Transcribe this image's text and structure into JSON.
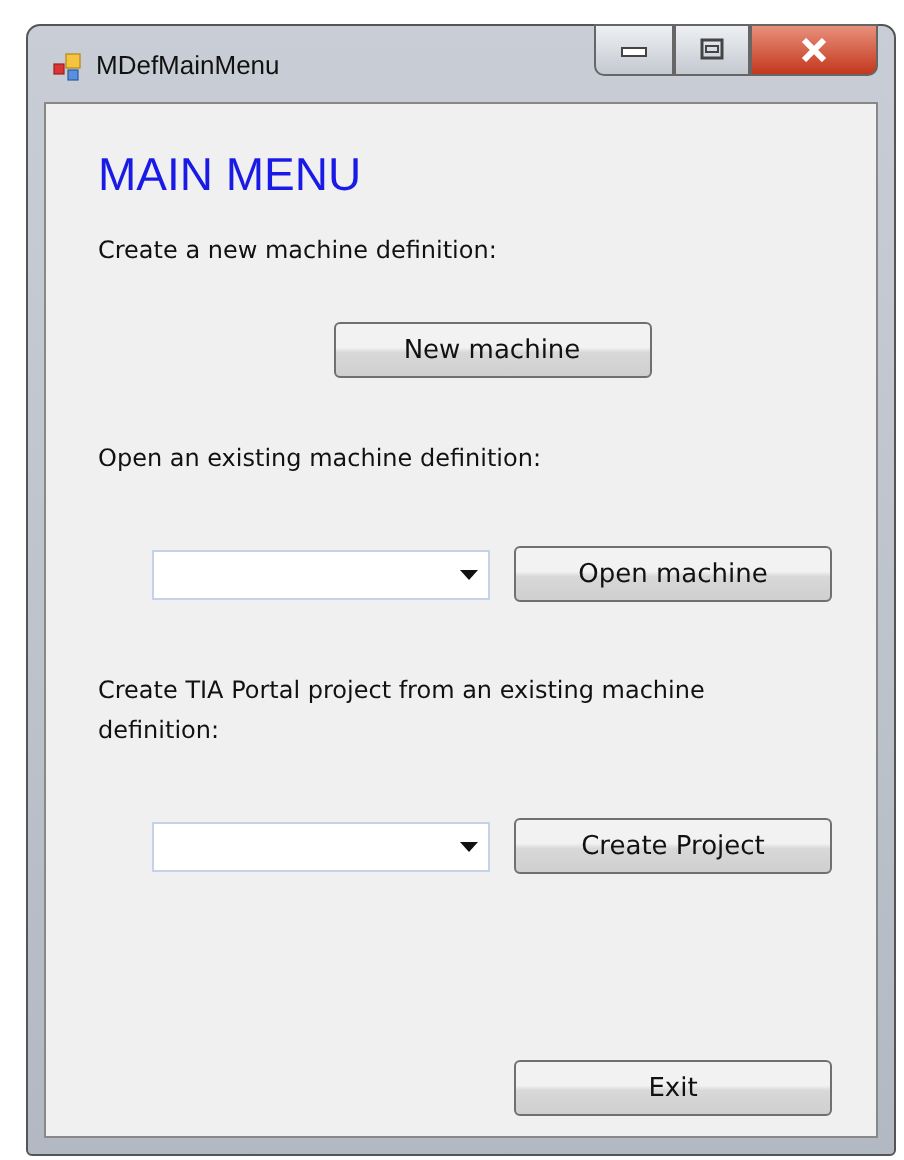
{
  "window": {
    "title": "MDefMainMenu"
  },
  "heading": "MAIN MENU",
  "sections": [
    {
      "label": "Create a new machine definition:",
      "button": "New machine",
      "kind": "button"
    },
    {
      "label": "Open an existing machine definition:",
      "button": "Open machine",
      "kind": "combo"
    },
    {
      "label": "Create TIA Portal project from an existing machine definition:",
      "button": "Create Project",
      "kind": "combo"
    }
  ],
  "exit_button": "Exit"
}
